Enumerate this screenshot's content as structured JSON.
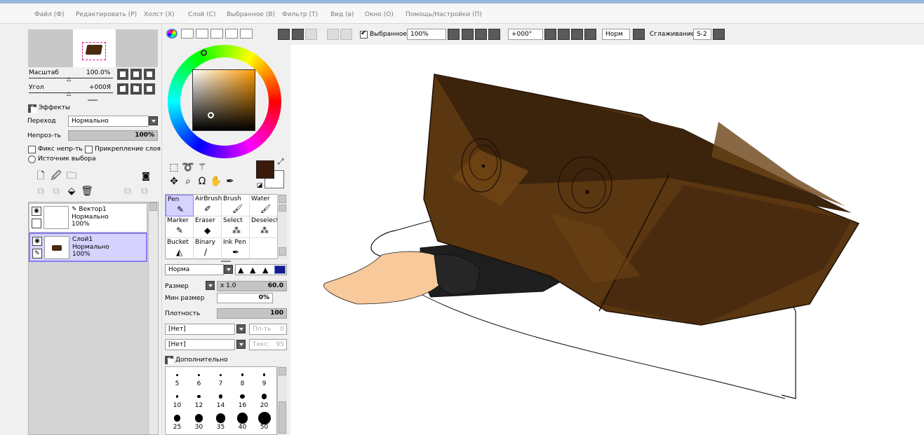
{
  "menu": [
    "Файл (Ф)",
    "Редактировать (Р)",
    "Холст (Х)",
    "Слой (С)",
    "Выбранное (В)",
    "Фильтр (Т)",
    "Вид (в)",
    "Окно (О)",
    "Помощь/Настройки (П)"
  ],
  "navigator": {
    "scale_label": "Масштаб",
    "scale_value": "100.0%",
    "angle_label": "Угол",
    "angle_value": "+000Я"
  },
  "layer_props": {
    "effects_label": "Эффекты",
    "blend_label": "Переход",
    "blend_value": "Нормально",
    "opacity_label": "Непроз-ть",
    "opacity_value": "100%",
    "protect_label": "Фикс непр-ть",
    "clip_label": "Прикрепление слоя",
    "selection_source_label": "Источник выбора"
  },
  "layers": [
    {
      "name": "Вектор1",
      "mode": "Нормально",
      "opacity": "100%"
    },
    {
      "name": "Слой1",
      "mode": "Нормально",
      "opacity": "100%"
    }
  ],
  "brushes": [
    {
      "label": "Pen",
      "icon": "pen-icon"
    },
    {
      "label": "AirBrush",
      "icon": "airbrush-icon"
    },
    {
      "label": "Brush",
      "icon": "brush-icon"
    },
    {
      "label": "Water",
      "icon": "water-icon"
    },
    {
      "label": "Marker",
      "icon": "marker-icon"
    },
    {
      "label": "Eraser",
      "icon": "eraser-icon"
    },
    {
      "label": "Select",
      "icon": "select-icon"
    },
    {
      "label": "Deselect",
      "icon": "deselect-icon"
    },
    {
      "label": "Bucket",
      "icon": "bucket-icon"
    },
    {
      "label": "Binary",
      "icon": "binary-icon"
    },
    {
      "label": "Ink Pen",
      "icon": "inkpen-icon"
    }
  ],
  "brush_settings": {
    "mode": "Норма",
    "size_label": "Размер",
    "size_mult": "x 1.0",
    "size_value": "60.0",
    "min_size_label": "Мин размер",
    "min_size_value": "0%",
    "density_label": "Плотность",
    "density_value": "100",
    "shape_1": "[Нет]",
    "shape_1_side": "Пл-ть",
    "shape_1_side_value": "0",
    "shape_2": "[Нет]",
    "shape_2_side": "Текс.",
    "shape_2_side_value": "95",
    "advanced_label": "Дополнительно"
  },
  "brush_sizes": [
    "5",
    "6",
    "7",
    "8",
    "9",
    "10",
    "12",
    "14",
    "16",
    "20",
    "25",
    "30",
    "35",
    "40",
    "50"
  ],
  "canvas_toolbar": {
    "selection_label": "Выбранное",
    "zoom": "100%",
    "rotation": "+000°",
    "mode_btn": "Норм",
    "smoothing_label": "Сглаживание",
    "smoothing_value": "S-2"
  },
  "colors": {
    "foreground": "#3a1a0a",
    "background": "#ffffff",
    "accent": "#8a7ff0"
  }
}
